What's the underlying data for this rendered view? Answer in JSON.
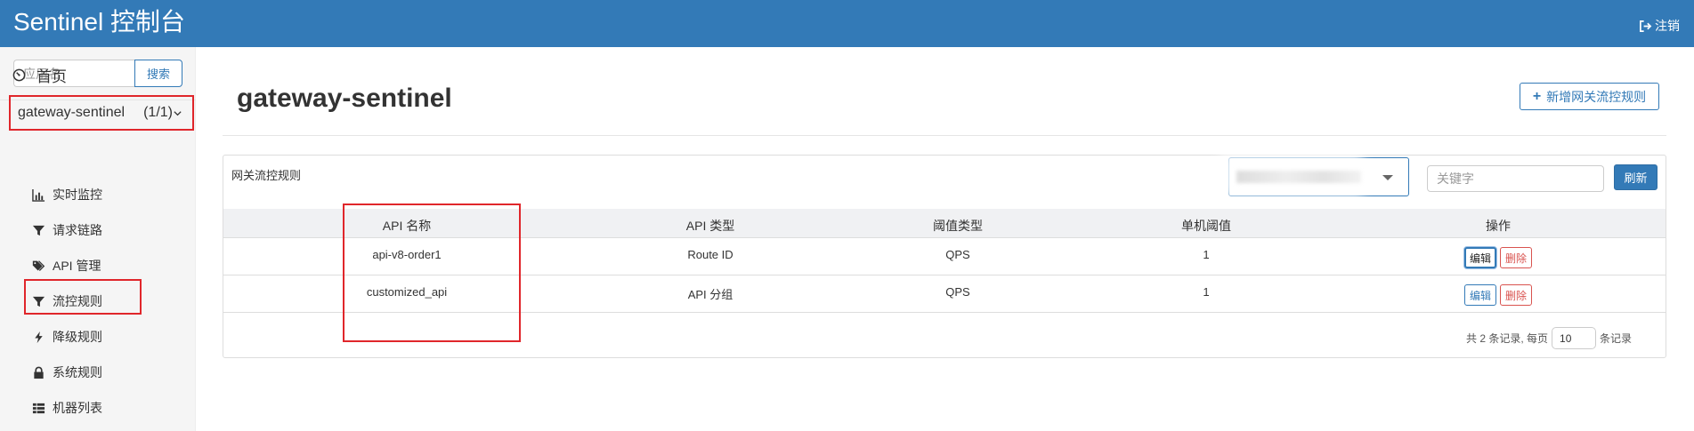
{
  "header": {
    "title": "Sentinel 控制台",
    "logout_label": "注销",
    "logout_icon": "sign-out-icon",
    "background_color": "#337ab7"
  },
  "sidebar": {
    "search": {
      "placeholder": "应用名",
      "value": "",
      "button_label": "搜索"
    },
    "home": {
      "label": "首页",
      "icon": "dashboard-icon"
    },
    "app": {
      "name": "gateway-sentinel",
      "count": "(1/1)",
      "icon": "chevron-down-icon"
    },
    "items": [
      {
        "label": "实时监控",
        "icon": "bar-chart-icon"
      },
      {
        "label": "请求链路",
        "icon": "filter-icon"
      },
      {
        "label": "API 管理",
        "icon": "tags-icon"
      },
      {
        "label": "流控规则",
        "icon": "filter-icon",
        "highlighted": true
      },
      {
        "label": "降级规则",
        "icon": "flash-icon"
      },
      {
        "label": "系统规则",
        "icon": "lock-icon"
      },
      {
        "label": "机器列表",
        "icon": "list-icon"
      }
    ]
  },
  "main": {
    "title": "gateway-sentinel",
    "add_button_label": "新增网关流控规则",
    "panel": {
      "title": "网关流控规则",
      "keyword_placeholder": "关键字",
      "refresh_label": "刷新"
    },
    "table": {
      "columns": [
        "API 名称",
        "API 类型",
        "阈值类型",
        "单机阈值",
        "操作"
      ],
      "rows": [
        {
          "api_name": "api-v8-order1",
          "api_type": "Route ID",
          "threshold_type": "QPS",
          "threshold": "1"
        },
        {
          "api_name": "customized_api",
          "api_type": "API 分组",
          "threshold_type": "QPS",
          "threshold": "1"
        }
      ],
      "edit_label": "编辑",
      "delete_label": "删除"
    },
    "pagination": {
      "prefix": "共 2 条记录, 每页",
      "page_size": "10",
      "suffix": "条记录"
    }
  },
  "colors": {
    "primary": "#337ab7",
    "danger": "#d9534f",
    "annotation_red": "#e0262b"
  }
}
